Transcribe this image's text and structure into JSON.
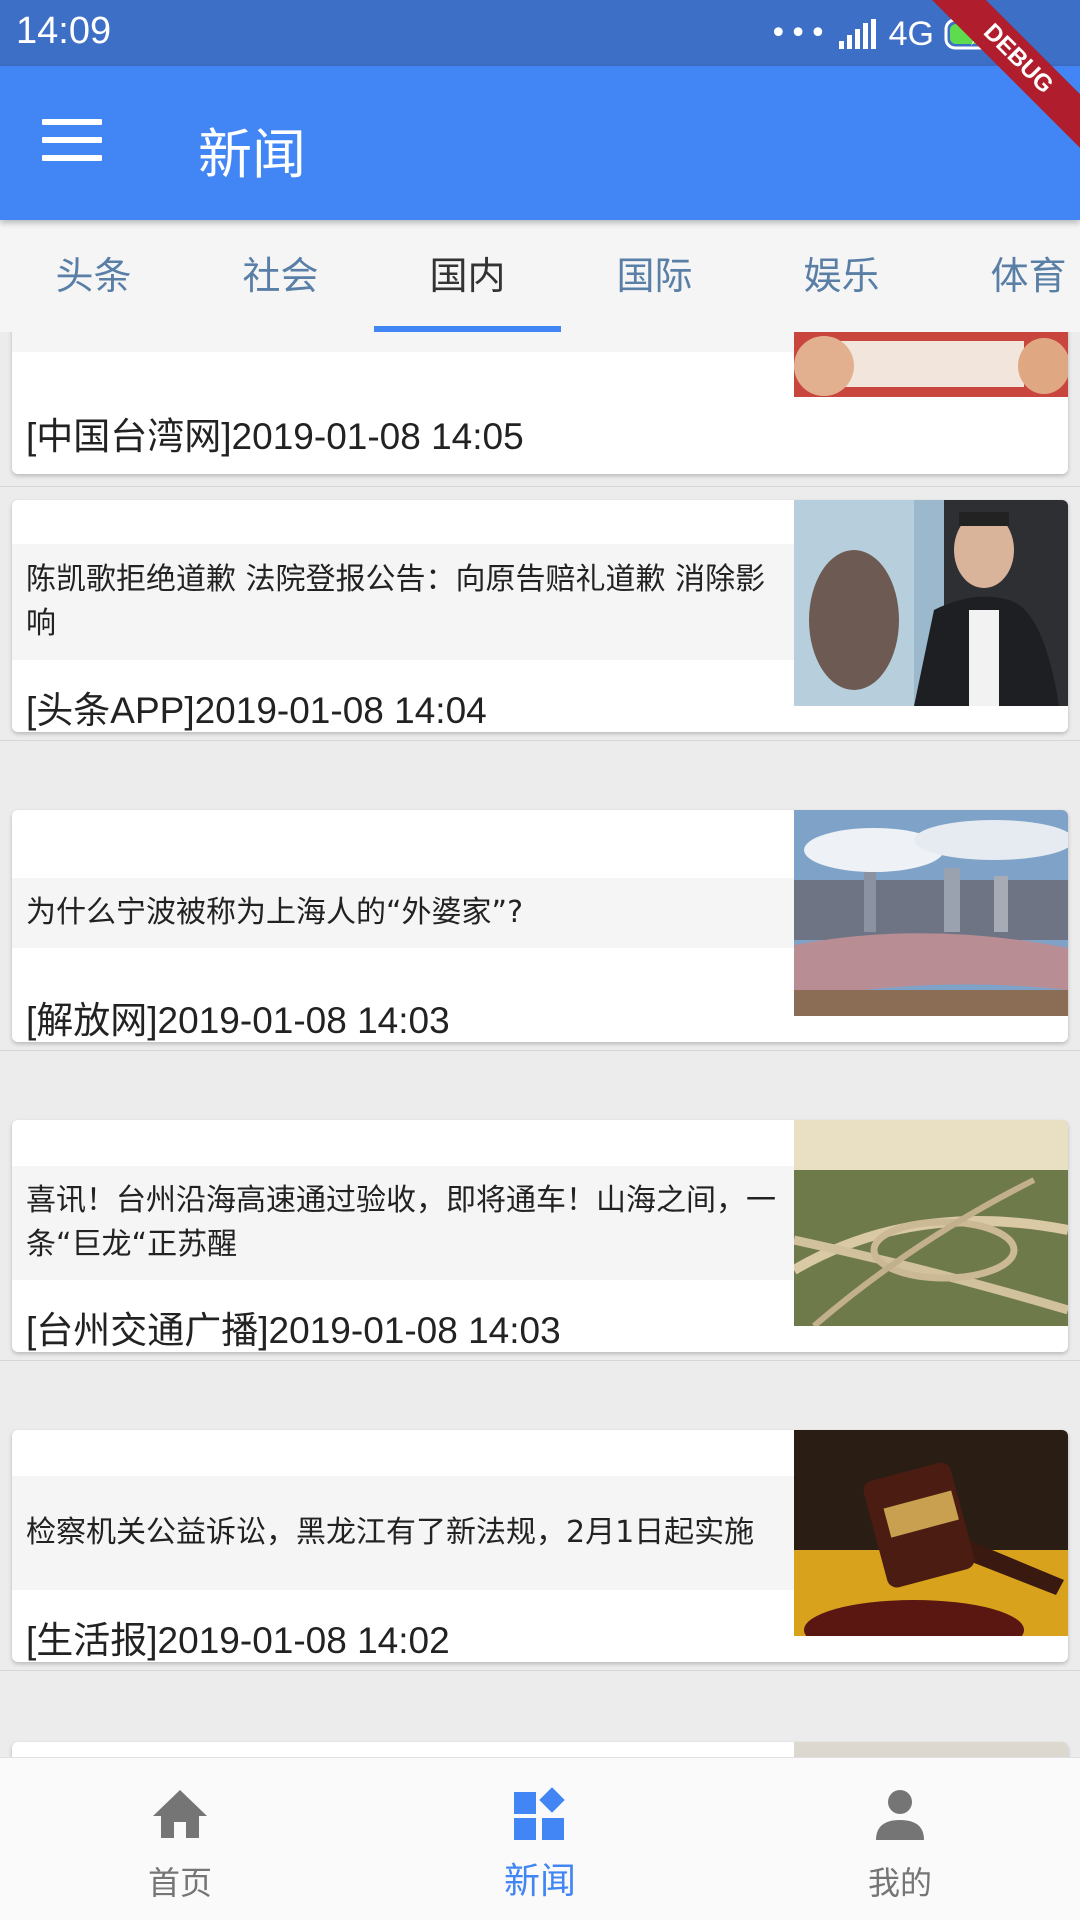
{
  "status_bar": {
    "time": "14:09",
    "signal_dots": "•••",
    "network": "4G",
    "debug": "DEBUG"
  },
  "app_bar": {
    "title": "新闻"
  },
  "tabs": [
    {
      "label": "头条"
    },
    {
      "label": "社会"
    },
    {
      "label": "国内"
    },
    {
      "label": "国际"
    },
    {
      "label": "娱乐"
    },
    {
      "label": "体育"
    }
  ],
  "active_tab": "国内",
  "articles": [
    {
      "title": "",
      "source": "[中国台湾网]2019-01-08 14:05"
    },
    {
      "title": "陈凯歌拒绝道歉 法院登报公告：向原告赔礼道歉 消除影响",
      "source": "[头条APP]2019-01-08 14:04"
    },
    {
      "title": "为什么宁波被称为上海人的“外婆家”?",
      "source": "[解放网]2019-01-08 14:03"
    },
    {
      "title": "喜讯！台州沿海高速通过验收，即将通车！山海之间，一条“巨龙“正苏醒",
      "source": "[台州交通广播]2019-01-08 14:03"
    },
    {
      "title": "检察机关公益诉讼，黑龙江有了新法规，2月1日起实施",
      "source": "[生活报]2019-01-08 14:02"
    }
  ],
  "bottom_nav": [
    {
      "label": "首页",
      "icon": "home-icon"
    },
    {
      "label": "新闻",
      "icon": "dashboard-icon"
    },
    {
      "label": "我的",
      "icon": "person-icon"
    }
  ],
  "colors": {
    "primary": "#4285f4",
    "status_bar": "#3d6fc6",
    "tab_inactive": "#5a7fa6",
    "debug_ribbon": "#b01d2c"
  }
}
